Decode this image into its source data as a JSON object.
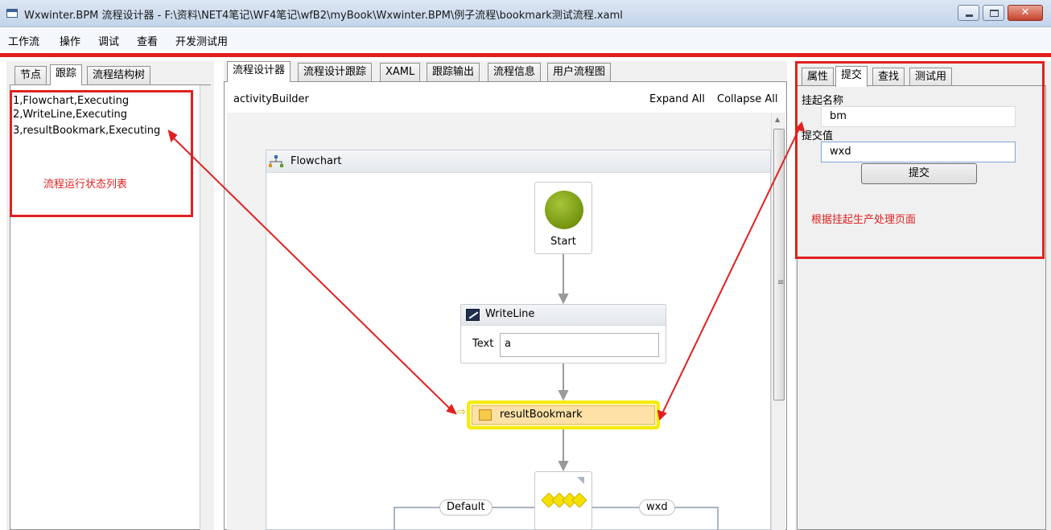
{
  "window": {
    "title": "Wxwinter.BPM 流程设计器  -   F:\\资料\\NET4笔记\\WF4笔记\\wfB2\\myBook\\Wxwinter.BPM\\例子流程\\bookmark测试流程.xaml",
    "close_glyph": "✕"
  },
  "menu": [
    "工作流",
    "操作",
    "调试",
    "查看",
    "开发测试用"
  ],
  "left_panel": {
    "tabs": [
      "节点",
      "跟踪",
      "流程结构树"
    ],
    "active_tab": "跟踪",
    "tracking_lines": [
      "1,Flowchart,Executing",
      "2,WriteLine,Executing",
      "3,resultBookmark,Executing"
    ],
    "annotation": "流程运行状态列表"
  },
  "center_panel": {
    "tabs": [
      "流程设计器",
      "流程设计跟踪",
      "XAML",
      "跟踪输出",
      "流程信息",
      "用户流程图"
    ],
    "active_tab": "流程设计器",
    "breadcrumb": "activityBuilder",
    "expand_all": "Expand All",
    "collapse_all": "Collapse All",
    "flowchart": {
      "title": "Flowchart",
      "start_label": "Start",
      "writeline": {
        "title": "WriteLine",
        "field_label": "Text",
        "field_value": "a"
      },
      "bookmark": {
        "title": "resultBookmark"
      },
      "switch": {
        "left_case": "Default",
        "right_case": "wxd"
      }
    }
  },
  "right_panel": {
    "tabs": [
      "属性",
      "提交",
      "查找",
      "测试用"
    ],
    "active_tab": "提交",
    "bookmark_name_label": "挂起名称",
    "bookmark_name_value": "bm",
    "submit_value_label": "提交值",
    "submit_value": "wxd",
    "submit_button": "提交",
    "annotation": "根据挂起生产处理页面"
  },
  "colors": {
    "annotation_red": "#e02020",
    "start_green": "#74940f",
    "bookmark_highlight": "#f5ea0a",
    "switch_diamond": "#f5e000"
  }
}
